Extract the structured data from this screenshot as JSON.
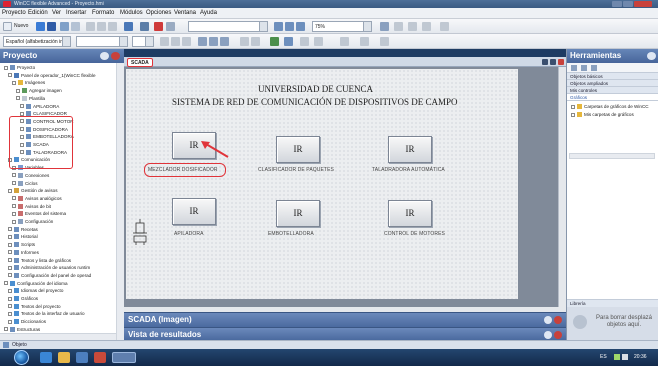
{
  "window": {
    "title": "WinCC flexible Advanced - Proyecto.hmi"
  },
  "menu": [
    "Proyecto",
    "Edición",
    "Ver",
    "Insertar",
    "Formato",
    "Módulos",
    "Opciones",
    "Ventana",
    "Ayuda"
  ],
  "toolbar": {
    "new_label": "Nuevo",
    "zoom_value": "75%",
    "font_value": "Español (alfabetización in..."
  },
  "left_panel": {
    "title": "Proyecto",
    "tree": [
      "Proyecto",
      "Panel de operador_1(WinCC flexible",
      "Imágenes",
      "Agregar imagen",
      "Plantilla",
      "APILADORA",
      "CLASIFICADOR",
      "CONTROL MOTOR",
      "DOSIFICADORA",
      "EMBOTELLADORA",
      "SCADA",
      "TALADRADORA",
      "Comunicación",
      "Variables",
      "Conexiones",
      "Ciclos",
      "Gestión de avisos",
      "Avisos analógicos",
      "Avisos de bit",
      "Eventos del sistema",
      "Configuración",
      "Recetas",
      "Historial",
      "Scripts",
      "Informes",
      "Textos y lista de gráficos",
      "Administración de usuarios runtim",
      "Configuración del panel de operad",
      "Configuración del idioma",
      "Idiomas del proyecto",
      "Gráficos",
      "Textos del proyecto",
      "Textos de la interfaz de usuario",
      "Diccionarios",
      "Estructuras"
    ]
  },
  "editor": {
    "tab": "SCADA",
    "heading1": "UNIVERSIDAD DE CUENCA",
    "heading2": "SISTEMA DE RED DE COMUNICACIÓN DE DISPOSITIVOS DE CAMPO",
    "buttons": [
      {
        "label": "IR",
        "caption": "MEZCLADOR DOSIFICADOR"
      },
      {
        "label": "IR",
        "caption": "CLASIFICADOR DE PAQUETES"
      },
      {
        "label": "IR",
        "caption": "TALADRADORA AUTOMÁTICA"
      },
      {
        "label": "IR",
        "caption": "APILADORA"
      },
      {
        "label": "IR",
        "caption": "EMBOTELLADORA"
      },
      {
        "label": "IR",
        "caption": "CONTROL DE MOTORES"
      }
    ]
  },
  "bottom_panels": {
    "properties": "SCADA (Imagen)",
    "results": "Vista de resultados"
  },
  "right_panel": {
    "title": "Herramientas",
    "sections": [
      "Objetos básicos",
      "Objetos ampliados",
      "Mis controles",
      "Gráficos"
    ],
    "graphics_items": [
      "Carpetas de gráficos de WinCC",
      "Mis carpetas de gráficos"
    ],
    "library_label": "Librería",
    "hint": "Para borrar desplazá objetos aquí."
  },
  "detail_bar": {
    "label": "Objeto"
  },
  "taskbar": {
    "lang": "ES",
    "time": "20:36"
  },
  "colors": {
    "accent": "#4b6a9f",
    "highlight": "#e0343a"
  }
}
